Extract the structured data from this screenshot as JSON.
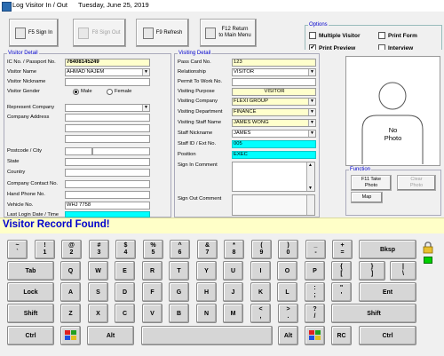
{
  "window": {
    "title": "Log Visitor In / Out",
    "date": "Tuesday, June 25, 2019"
  },
  "toolbar": {
    "sign_in": "F5 Sign In",
    "sign_out": "F8 Sign Out",
    "refresh": "F9 Refresh",
    "return_line1": "F12 Return",
    "return_line2": "to Main Menu"
  },
  "options": {
    "title": "Options",
    "multiple_visitor": "Multiple Visitor",
    "print_form": "Print Form",
    "print_preview": "Print Preview",
    "interview": "Interview",
    "print_preview_checked": true
  },
  "visitor": {
    "group_title": "Visitor Detail",
    "ic_label": "IC No. / Passport No.",
    "ic_value": "76408145249",
    "name_label": "Visitor Name",
    "name_value": "AHMAD NAJEM",
    "nickname_label": "Visitor Nickname",
    "gender_label": "Visitor Gender",
    "male": "Male",
    "female": "Female",
    "company_label": "Represent Company",
    "address_label": "Company Address",
    "postcode_label": "Postcode / City",
    "state_label": "State",
    "country_label": "Country",
    "contact_label": "Company Contact No.",
    "phone_label": "Hand Phone No.",
    "vehicle_label": "Vehicle No.",
    "vehicle_value": "WHJ 7758",
    "last_login_label": "Last Login Date / Time"
  },
  "visiting": {
    "group_title": "Visiting Detail",
    "pass_label": "Pass Card No.",
    "pass_value": "123",
    "relationship_label": "Relationship",
    "relationship_value": "VISITOR",
    "permit_label": "Permit To Work No.",
    "purpose_label": "Visiting Purpose",
    "purpose_value": "VISITOR",
    "company_label": "Visiting Company",
    "company_value": "FLEXI GROUP",
    "department_label": "Visiting Department",
    "department_value": "FINANCE",
    "staff_name_label": "Visiting Staff Name",
    "staff_name_value": "JAMES WONG",
    "staff_nick_label": "Staff Nickname",
    "staff_nick_value": "JAMES",
    "staff_id_label": "Staff ID / Ext No.",
    "staff_id_value": "005",
    "position_label": "Position",
    "position_value": "EXEC",
    "signin_comment_label": "Sign In Comment",
    "signout_comment_label": "Sign Out Comment"
  },
  "photo": {
    "line1": "No",
    "line2": "Photo"
  },
  "function": {
    "title": "Function",
    "take_photo_line1": "F11 Take",
    "take_photo_line2": "Photo",
    "clear_photo_line1": "Clear",
    "clear_photo_line2": "Photo",
    "map": "Map"
  },
  "status_message": "Visitor Record Found!",
  "keyboard": {
    "row1": [
      {
        "top": "~",
        "bot": "`"
      },
      {
        "top": "!",
        "bot": "1"
      },
      {
        "top": "@",
        "bot": "2"
      },
      {
        "top": "#",
        "bot": "3"
      },
      {
        "top": "$",
        "bot": "4"
      },
      {
        "top": "%",
        "bot": "5"
      },
      {
        "top": "^",
        "bot": "6"
      },
      {
        "top": "&",
        "bot": "7"
      },
      {
        "top": "*",
        "bot": "8"
      },
      {
        "top": "(",
        "bot": "9"
      },
      {
        "top": ")",
        "bot": "0"
      },
      {
        "top": "_",
        "bot": "-"
      },
      {
        "top": "+",
        "bot": "="
      }
    ],
    "bksp": "Bksp",
    "tab": "Tab",
    "row2": [
      "Q",
      "W",
      "E",
      "R",
      "T",
      "Y",
      "U",
      "I",
      "O",
      "P"
    ],
    "row2b": [
      {
        "top": "{",
        "bot": "["
      },
      {
        "top": "}",
        "bot": "]"
      },
      {
        "top": "|",
        "bot": "\\"
      }
    ],
    "lock": "Lock",
    "row3": [
      "A",
      "S",
      "D",
      "F",
      "G",
      "H",
      "J",
      "K",
      "L"
    ],
    "row3b": [
      {
        "top": ":",
        "bot": ";"
      },
      {
        "top": "\"",
        "bot": "'"
      }
    ],
    "ent": "Ent",
    "shift": "Shift",
    "row4": [
      "Z",
      "X",
      "C",
      "V",
      "B",
      "N",
      "M"
    ],
    "row4b": [
      {
        "top": "<",
        "bot": ","
      },
      {
        "top": ">",
        "bot": "."
      },
      {
        "top": "?",
        "bot": "/"
      }
    ],
    "ctrl": "Ctrl",
    "alt": "Alt",
    "rc": "RC"
  }
}
